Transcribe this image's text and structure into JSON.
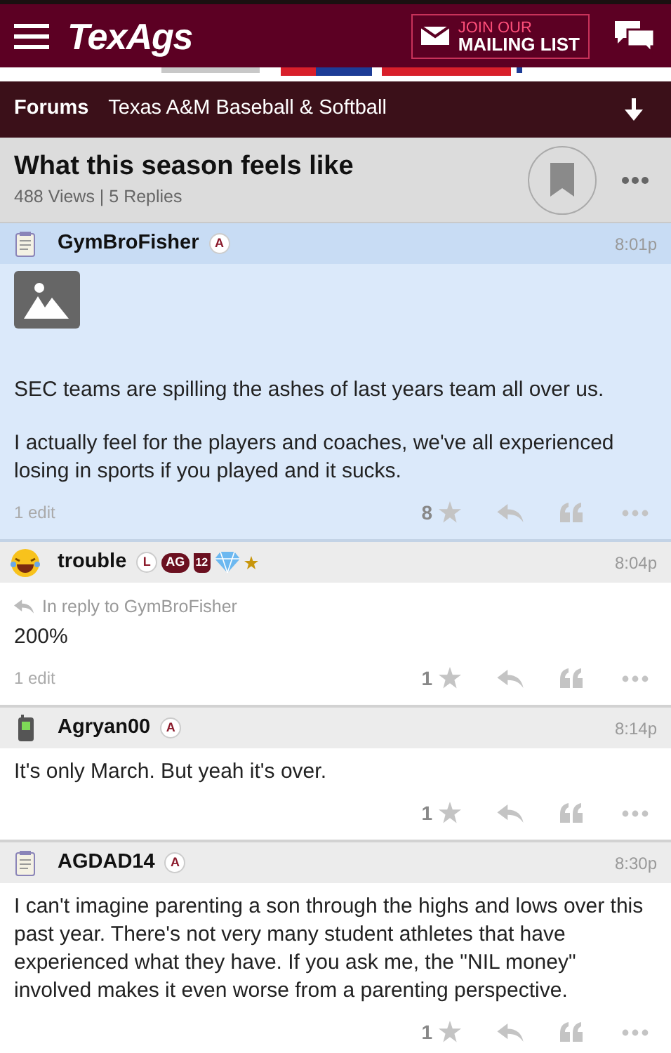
{
  "header": {
    "logo": "TexAgs",
    "mailing_top": "JOIN OUR",
    "mailing_bottom": "MAILING LIST"
  },
  "breadcrumb": {
    "forums": "Forums",
    "board": "Texas A&M Baseball & Softball"
  },
  "thread": {
    "title": "What this season feels like",
    "stats": "488 Views | 5 Replies",
    "bookmarked": false
  },
  "posts": [
    {
      "author": "GymBroFisher",
      "avatar": {
        "kind": "note"
      },
      "badges": [
        {
          "kind": "circle",
          "text": "A"
        }
      ],
      "time": "8:01p",
      "selected": true,
      "image": true,
      "paragraphs": [
        "SEC teams are spilling the ashes of last years team all over us.",
        "I actually feel for the players and coaches, we've all experienced losing in sports if you played and it sucks."
      ],
      "edits": "1 edit",
      "likes": "8"
    },
    {
      "author": "trouble",
      "avatar": {
        "kind": "emoji"
      },
      "badges": [
        {
          "kind": "circle",
          "text": "L"
        },
        {
          "kind": "pill",
          "text": "AG"
        },
        {
          "kind": "shield",
          "text": "12"
        },
        {
          "kind": "diamond"
        },
        {
          "kind": "star"
        }
      ],
      "time": "8:04p",
      "selected": false,
      "reply_to": "In reply to GymBroFisher",
      "paragraphs": [
        "200%"
      ],
      "edits": "1 edit",
      "likes": "1"
    },
    {
      "author": "Agryan00",
      "avatar": {
        "kind": "phone"
      },
      "badges": [
        {
          "kind": "circle",
          "text": "A"
        }
      ],
      "time": "8:14p",
      "selected": false,
      "paragraphs": [
        "It's only March. But yeah it's over."
      ],
      "likes": "1"
    },
    {
      "author": "AGDAD14",
      "avatar": {
        "kind": "note"
      },
      "badges": [
        {
          "kind": "circle",
          "text": "A"
        }
      ],
      "time": "8:30p",
      "selected": false,
      "paragraphs": [
        "I can't imagine parenting a son through the highs and lows over this past year. There's not very many student athletes that have experienced what they have. If you ask me, the \"NIL money\" involved makes it even worse from a parenting perspective."
      ],
      "likes": "1"
    }
  ]
}
